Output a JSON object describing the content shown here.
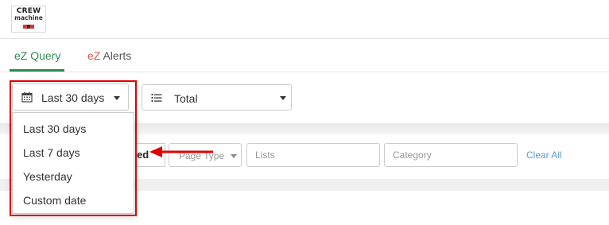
{
  "logo": {
    "line1": "CREW",
    "line2": "machine"
  },
  "tabs": [
    {
      "label_prefix": "eZ",
      "label_rest": " Query",
      "active": true
    },
    {
      "label_prefix": "eZ",
      "label_rest": " Alerts",
      "active": false
    }
  ],
  "date_select": {
    "value": "Last 30 days",
    "icon": "calendar-icon"
  },
  "total_select": {
    "value": "Total",
    "icon": "list-icon"
  },
  "date_menu": {
    "items": [
      "Last 30 days",
      "Last 7 days",
      "Yesterday",
      "Custom date"
    ]
  },
  "filters": {
    "hidden_label": "ed",
    "page_type_placeholder": "Page Type",
    "lists_placeholder": "Lists",
    "category_placeholder": "Category",
    "clear_all": "Clear All"
  },
  "colors": {
    "accent": "#2e8b57",
    "annotation": "#e00000",
    "link": "#5b9bd5"
  }
}
